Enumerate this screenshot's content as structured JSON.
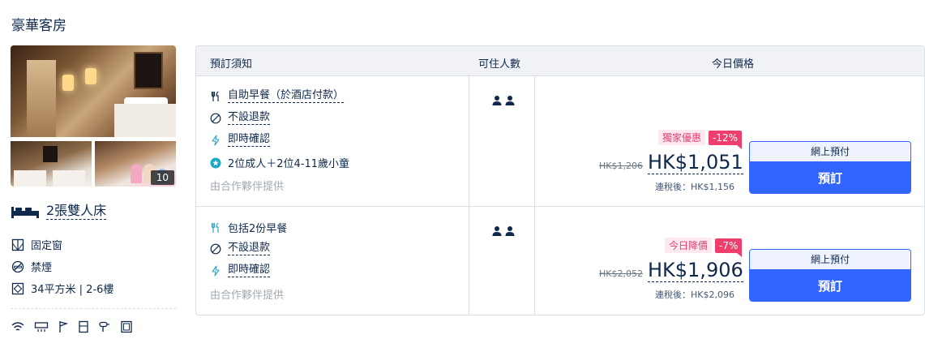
{
  "room": {
    "title": "豪華客房",
    "photo_count": "10",
    "bed": "2張雙人床",
    "features": [
      "固定窗",
      "禁煙",
      "34平方米 | 2-6樓"
    ]
  },
  "table": {
    "headers": [
      "預訂須知",
      "可住人數",
      "今日價格"
    ],
    "rows": [
      {
        "conditions": [
          "自助早餐（於酒店付款）",
          "不設退款",
          "即時確認",
          "2位成人＋2位4-11歲小童"
        ],
        "provider": "由合作夥伴提供",
        "promo_label": "獨家優惠",
        "discount": "-12%",
        "original_price": "HK$1,206",
        "price": "HK$1,051",
        "tax_note": "連稅後：HK$1,156",
        "payment_label": "網上預付",
        "book_label": "預訂"
      },
      {
        "conditions": [
          "包括2份早餐",
          "不設退款",
          "即時確認"
        ],
        "provider": "由合作夥伴提供",
        "promo_label": "今日降價",
        "discount": "-7%",
        "original_price": "HK$2,052",
        "price": "HK$1,906",
        "tax_note": "連稅後：HK$2,096",
        "payment_label": "網上預付",
        "book_label": "預訂"
      }
    ]
  },
  "colors": {
    "primary": "#3264ff",
    "promo": "#ee3e6b",
    "text": "#0f294d"
  }
}
